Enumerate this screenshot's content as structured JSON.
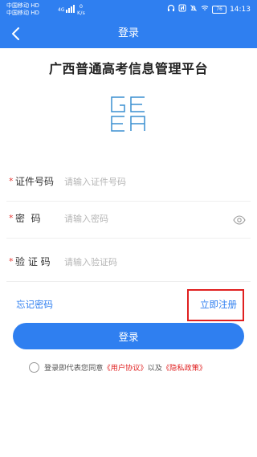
{
  "status_bar": {
    "carrier_1": "中国移动",
    "carrier_1_badge": "HD",
    "carrier_2": "中国移动",
    "carrier_2_badge": "HD",
    "network": "4G",
    "speed_value": "0",
    "speed_unit": "K/s",
    "battery": "76",
    "time": "14:13"
  },
  "navbar": {
    "title": "登录",
    "back_icon": "chevron-left-icon"
  },
  "header": {
    "platform_title": "广西普通高考信息管理平台",
    "logo_text": [
      "GE",
      "EA"
    ]
  },
  "form": {
    "id_number": {
      "required_mark": "*",
      "label": "证件号码",
      "placeholder": "请输入证件号码",
      "value": ""
    },
    "password": {
      "required_mark": "*",
      "label": "密  码",
      "placeholder": "请输入密码",
      "value": "",
      "toggle_icon": "eye-icon"
    },
    "captcha": {
      "required_mark": "*",
      "label": "验 证 码",
      "placeholder": "请输入验证码",
      "value": ""
    }
  },
  "links": {
    "forgot_password": "忘记密码",
    "register": "立即注册"
  },
  "login_button": "登录",
  "agreement": {
    "prefix": "登录即代表您同意",
    "user_agreement": "《用户协议》",
    "middle": "以及",
    "privacy_policy": "《隐私政策》",
    "checked": false
  },
  "colors": {
    "primary": "#2f7ff0",
    "required": "#e53935",
    "highlight_border": "#e02020",
    "link_red": "#e02020"
  }
}
